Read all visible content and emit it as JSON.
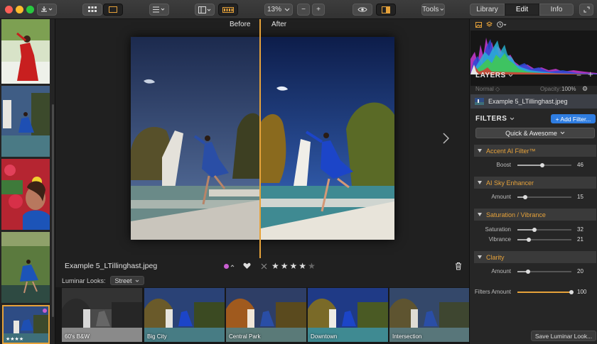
{
  "toolbar": {
    "zoom_value": "13%",
    "zoom_out": "−",
    "zoom_in": "+",
    "tools_label": "Tools",
    "tabs": [
      "Library",
      "Edit",
      "Info"
    ]
  },
  "viewer": {
    "before_label": "Before",
    "after_label": "After",
    "filename": "Example 5_LTillinghast.jpeg",
    "rating": 4,
    "max_rating": 5,
    "color_label": "#c85ed0"
  },
  "looks": {
    "label": "Luminar Looks:",
    "category": "Street",
    "items": [
      "60's B&W",
      "Big City",
      "Central Park",
      "Downtown",
      "Intersection"
    ]
  },
  "panel": {
    "layers_title": "LAYERS",
    "blend_mode": "Normal",
    "opacity_label": "Opacity:",
    "opacity_value": "100%",
    "layer_name": "Example 5_LTillinghast.jpeg",
    "filters_title": "FILTERS",
    "add_filter_label": "+ Add Filter...",
    "preset": "Quick & Awesome",
    "filters": [
      {
        "name": "Accent AI Filter™",
        "sliders": [
          {
            "label": "Boost",
            "value": 46
          }
        ]
      },
      {
        "name": "AI Sky Enhancer",
        "sliders": [
          {
            "label": "Amount",
            "value": 15
          }
        ]
      },
      {
        "name": "Saturation / Vibrance",
        "sliders": [
          {
            "label": "Saturation",
            "value": 32
          },
          {
            "label": "Vibrance",
            "value": 21
          }
        ]
      },
      {
        "name": "Clarity",
        "sliders": [
          {
            "label": "Amount",
            "value": 20
          }
        ]
      }
    ],
    "filters_amount_label": "Filters Amount",
    "filters_amount_value": 100,
    "save_look_label": "Save Luminar Look..."
  },
  "colors": {
    "accent": "#e6a23a",
    "primary_button": "#2f7de1"
  }
}
